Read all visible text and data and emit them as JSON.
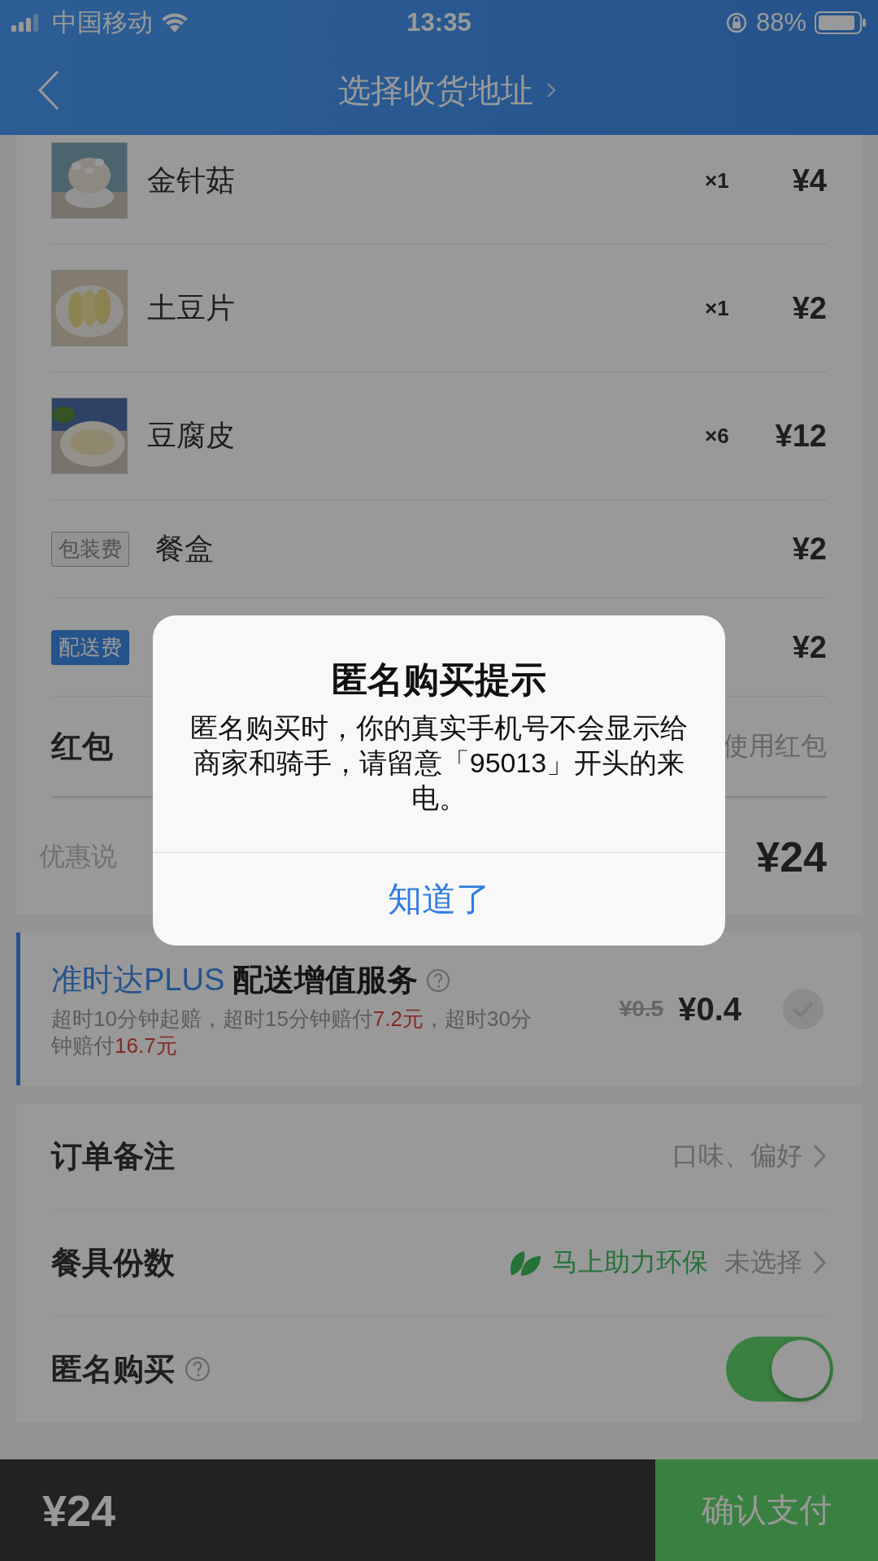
{
  "status_bar": {
    "carrier": "中国移动",
    "time": "13:35",
    "battery": "88%"
  },
  "nav": {
    "title": "选择收货地址"
  },
  "order_items": [
    {
      "name": "金针菇",
      "quantity": "×1",
      "price": "¥4"
    },
    {
      "name": "土豆片",
      "quantity": "×1",
      "price": "¥2"
    },
    {
      "name": "豆腐皮",
      "quantity": "×6",
      "price": "¥12"
    }
  ],
  "fees": [
    {
      "kind": "packaging",
      "tag": "包装费",
      "name": "餐盒",
      "price": "¥2"
    },
    {
      "kind": "delivery",
      "tag": "配送费",
      "price": "¥2"
    }
  ],
  "red_packet": {
    "label": "红包",
    "hint": "使用红包"
  },
  "summary": {
    "label": "优惠说",
    "total": "¥24"
  },
  "plus_service": {
    "brand": "准时达PLUS",
    "title": "配送增值服务",
    "description": [
      {
        "text": "超时10分钟起赔，超时15分钟赔付",
        "highlight": false
      },
      {
        "text": "7.2元",
        "highlight": true
      },
      {
        "text": "，超时30分钟赔付",
        "highlight": false
      },
      {
        "text": "16.7元",
        "highlight": true
      }
    ],
    "old_price": "¥0.5",
    "price": "¥0.4",
    "checked": false
  },
  "options": [
    {
      "kind": "link",
      "label": "订单备注",
      "hint": "口味、偏好"
    },
    {
      "kind": "link",
      "label": "餐具份数",
      "eco": "马上助力环保",
      "hint": "未选择"
    },
    {
      "kind": "toggle",
      "label": "匿名购买",
      "on": true
    }
  ],
  "bottom_bar": {
    "total": "¥24",
    "button": "确认支付"
  },
  "dialog": {
    "title": "匿名购买提示",
    "message": "匿名购买时，你的真实手机号不会显示给商家和骑手，请留意「95013」开头的来电。",
    "button": "知道了"
  }
}
